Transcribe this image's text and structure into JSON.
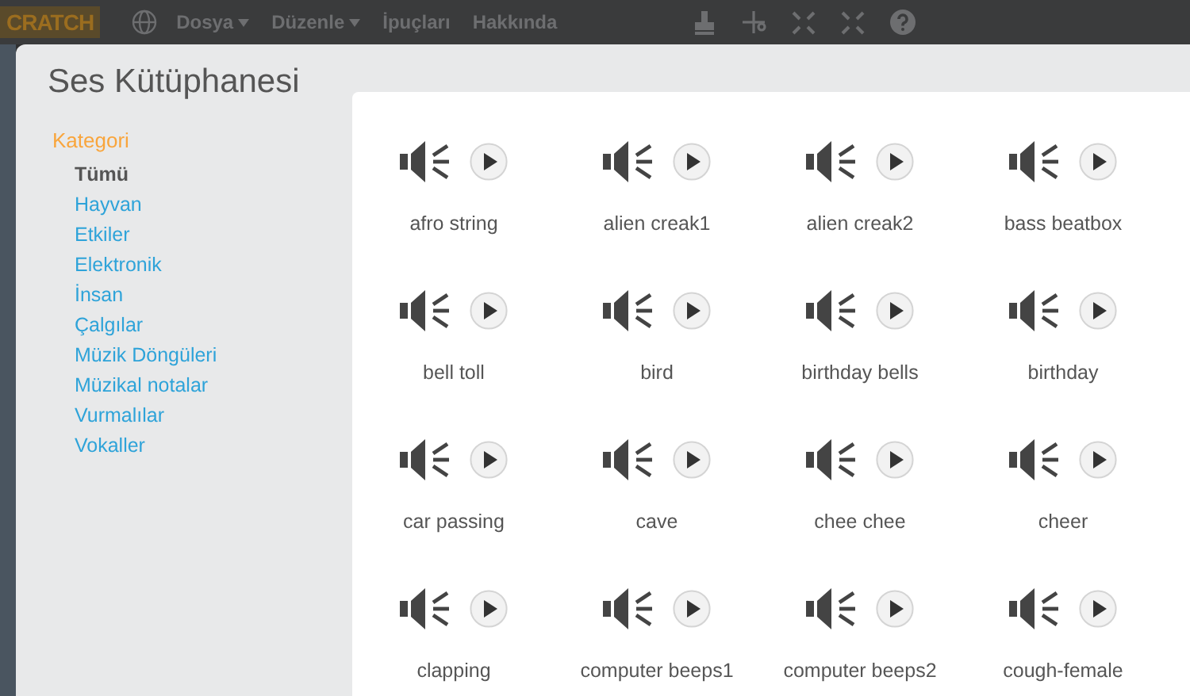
{
  "menubar": {
    "logo": "CRATCH",
    "menus": [
      {
        "label": "Dosya",
        "dropdown": true
      },
      {
        "label": "Düzenle",
        "dropdown": true
      },
      {
        "label": "İpuçları",
        "dropdown": false
      },
      {
        "label": "Hakkında",
        "dropdown": false
      }
    ]
  },
  "dialog": {
    "title": "Ses Kütüphanesi",
    "category_heading": "Kategori",
    "categories": [
      {
        "label": "Tümü",
        "selected": true
      },
      {
        "label": "Hayvan",
        "selected": false
      },
      {
        "label": "Etkiler",
        "selected": false
      },
      {
        "label": "Elektronik",
        "selected": false
      },
      {
        "label": "İnsan",
        "selected": false
      },
      {
        "label": "Çalgılar",
        "selected": false
      },
      {
        "label": "Müzik Döngüleri",
        "selected": false
      },
      {
        "label": "Müzikal notalar",
        "selected": false
      },
      {
        "label": "Vurmalılar",
        "selected": false
      },
      {
        "label": "Vokaller",
        "selected": false
      }
    ],
    "sounds": [
      "afro string",
      "alien creak1",
      "alien creak2",
      "bass beatbox",
      "bell toll",
      "bird",
      "birthday bells",
      "birthday",
      "car passing",
      "cave",
      "chee chee",
      "cheer",
      "clapping",
      "computer beeps1",
      "computer beeps2",
      "cough-female"
    ]
  }
}
